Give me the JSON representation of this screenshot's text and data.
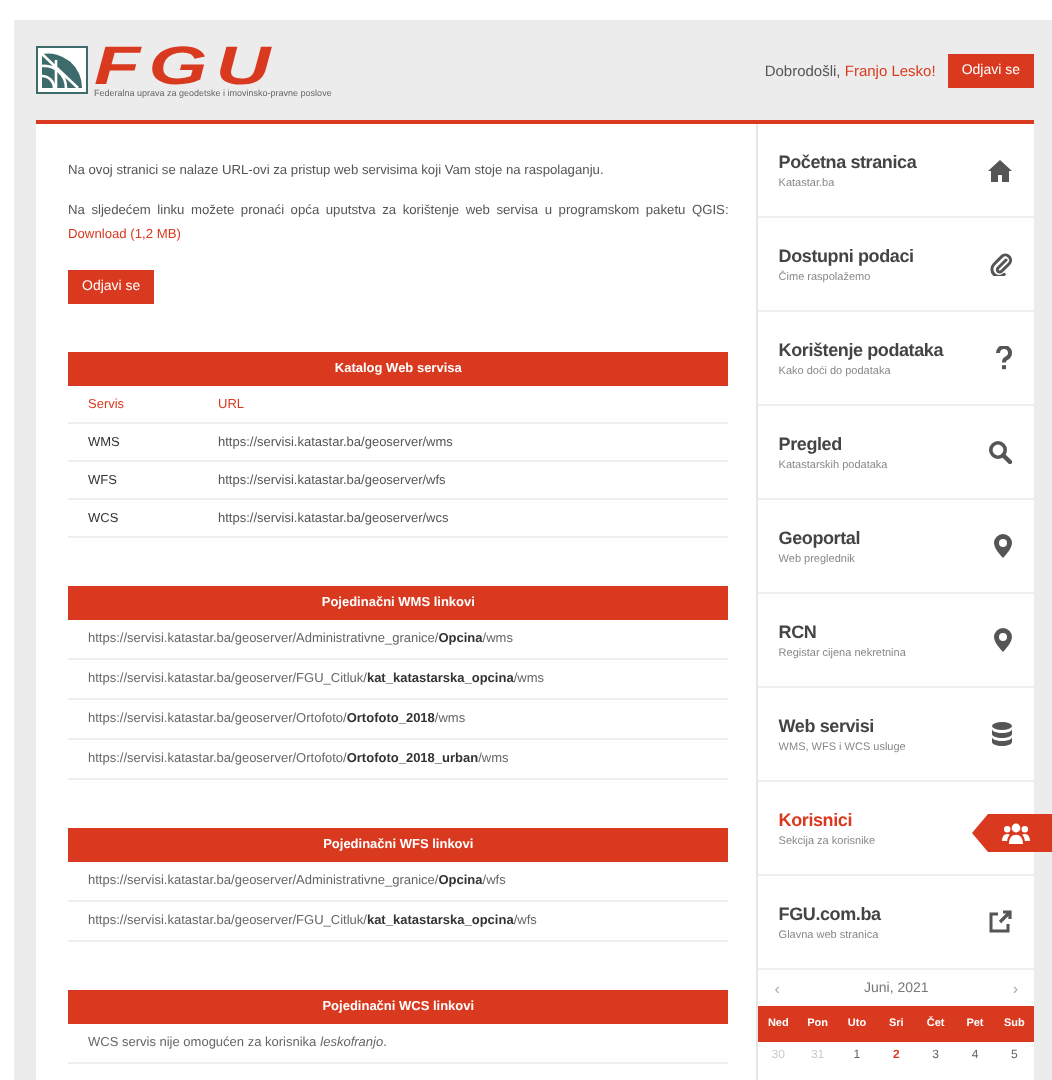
{
  "header": {
    "logo": {
      "text": "FGU",
      "subtitle": "Federalna uprava za geodetske i imovinsko-pravne poslove"
    },
    "greeting": "Dobrodošli,",
    "user": "Franjo Lesko!",
    "logout_button": "Odjavi se"
  },
  "main": {
    "intro": "Na ovoj stranici se nalaze URL-ovi za pristup web servisima koji Vam stoje na raspolaganju.",
    "download_text": "Na sljedećem linku možete pronaći opća uputstva za korištenje web servisa u programskom paketu QGIS:",
    "download_link": "Download (1,2 MB)",
    "logout_button": "Odjavi se"
  },
  "catalog": {
    "title": "Katalog Web servisa",
    "columns": [
      "Servis",
      "URL"
    ],
    "rows": [
      {
        "service": "WMS",
        "url": "https://servisi.katastar.ba/geoserver/wms"
      },
      {
        "service": "WFS",
        "url": "https://servisi.katastar.ba/geoserver/wfs"
      },
      {
        "service": "WCS",
        "url": "https://servisi.katastar.ba/geoserver/wcs"
      }
    ]
  },
  "sections": [
    {
      "title": "Pojedinačni WMS linkovi",
      "lines": [
        "https://servisi.katastar.ba/geoserver/Administrativne_granice/**Opcina**/wms",
        "https://servisi.katastar.ba/geoserver/FGU_Citluk/**kat_katastarska_opcina**/wms",
        "https://servisi.katastar.ba/geoserver/Ortofoto/**Ortofoto_2018**/wms",
        "https://servisi.katastar.ba/geoserver/Ortofoto/**Ortofoto_2018_urban**/wms"
      ]
    },
    {
      "title": "Pojedinačni WFS linkovi",
      "lines": [
        "https://servisi.katastar.ba/geoserver/Administrativne_granice/**Opcina**/wfs",
        "https://servisi.katastar.ba/geoserver/FGU_Citluk/**kat_katastarska_opcina**/wfs"
      ]
    },
    {
      "title": "Pojedinačni WCS linkovi",
      "lines": [
        "WCS servis nije omogućen za korisnika *leskofranjo*."
      ]
    }
  ],
  "sidebar": {
    "items": [
      {
        "title": "Početna stranica",
        "subtitle": "Katastar.ba",
        "kind": "home",
        "selected": false
      },
      {
        "title": "Dostupni podaci",
        "subtitle": "Čime raspolažemo",
        "kind": "paperclip",
        "selected": false
      },
      {
        "title": "Korištenje podataka",
        "subtitle": "Kako doći do podataka",
        "kind": "question",
        "selected": false
      },
      {
        "title": "Pregled",
        "subtitle": "Katastarskih podataka",
        "kind": "search",
        "selected": false
      },
      {
        "title": "Geoportal",
        "subtitle": "Web preglednik",
        "kind": "pin",
        "selected": false
      },
      {
        "title": "RCN",
        "subtitle": "Registar cijena nekretnina",
        "kind": "pin",
        "selected": false
      },
      {
        "title": "Web servisi",
        "subtitle": "WMS, WFS i WCS usluge",
        "kind": "database",
        "selected": false
      },
      {
        "title": "Korisnici",
        "subtitle": "Sekcija za korisnike",
        "kind": "users",
        "selected": true
      },
      {
        "title": "FGU.com.ba",
        "subtitle": "Glavna web stranica",
        "kind": "external",
        "selected": false
      }
    ]
  },
  "calendar": {
    "prev": "‹",
    "month": "Juni, 2021",
    "next": "›",
    "weekdays": [
      "Ned",
      "Pon",
      "Uto",
      "Sri",
      "Čet",
      "Pet",
      "Sub"
    ],
    "days": [
      {
        "label": "30",
        "muted": true,
        "today": false
      },
      {
        "label": "31",
        "muted": true,
        "today": false
      },
      {
        "label": "1",
        "muted": false,
        "today": false
      },
      {
        "label": "2",
        "muted": false,
        "today": true
      },
      {
        "label": "3",
        "muted": false,
        "today": false
      },
      {
        "label": "4",
        "muted": false,
        "today": false
      },
      {
        "label": "5",
        "muted": false,
        "today": false
      }
    ]
  }
}
